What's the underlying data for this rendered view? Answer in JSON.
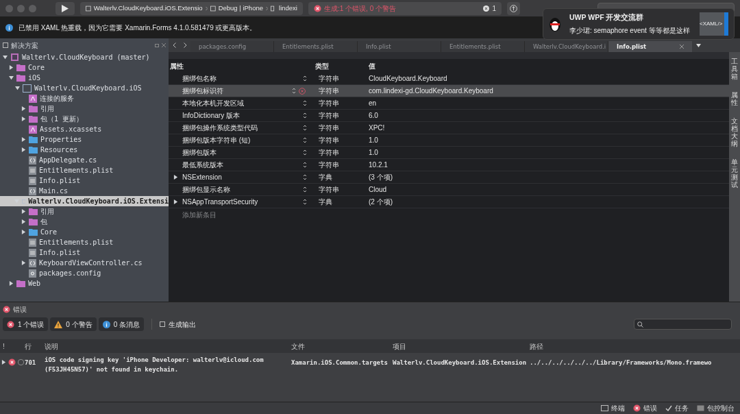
{
  "toolbar": {
    "breadcrumbs": [
      "Walterlv.CloudKeyboard.iOS.Extensio",
      "Debug | iPhone",
      "lindexi"
    ],
    "build_status": "生成:1 个错误, 0 个警告",
    "error_count": "1"
  },
  "notification": {
    "title": "UWP WPF 开发交流群",
    "message": "李少珺: semaphore event 等等都是这样",
    "badge": "<XAML/>"
  },
  "info_bar": {
    "message": "已禁用 XAML 热重载，因为它需要 Xamarin.Forms 4.1.0.581479 或更高版本。"
  },
  "solution_pad": {
    "title": "解决方案",
    "tree": [
      {
        "label": "Walterlv.CloudKeyboard (master)",
        "kind": "solution",
        "expanded": true,
        "selected": false,
        "children": [
          {
            "label": "Core",
            "kind": "folder",
            "expanded": false,
            "selected": false
          },
          {
            "label": "iOS",
            "kind": "folder",
            "expanded": true,
            "selected": false,
            "children": [
              {
                "label": "Walterlv.CloudKeyboard.iOS",
                "kind": "project",
                "expanded": true,
                "selected": false,
                "children": [
                  {
                    "label": "连接的服务",
                    "kind": "special",
                    "selected": false
                  },
                  {
                    "label": "引用",
                    "kind": "folder",
                    "expanded": false,
                    "selected": false
                  },
                  {
                    "label": "包（1 更新）",
                    "kind": "folder",
                    "expanded": false,
                    "selected": false
                  },
                  {
                    "label": "Assets.xcassets",
                    "kind": "special",
                    "selected": false
                  },
                  {
                    "label": "Properties",
                    "kind": "dir",
                    "expanded": false,
                    "selected": false
                  },
                  {
                    "label": "Resources",
                    "kind": "dir",
                    "expanded": false,
                    "selected": false
                  },
                  {
                    "label": "AppDelegate.cs",
                    "kind": "code",
                    "selected": false
                  },
                  {
                    "label": "Entitlements.plist",
                    "kind": "file",
                    "selected": false
                  },
                  {
                    "label": "Info.plist",
                    "kind": "file",
                    "selected": false
                  },
                  {
                    "label": "Main.cs",
                    "kind": "code",
                    "selected": false
                  }
                ]
              },
              {
                "label": "Walterlv.CloudKeyboard.iOS.Extensi",
                "kind": "project",
                "expanded": true,
                "selected": true,
                "children": [
                  {
                    "label": "引用",
                    "kind": "folder",
                    "expanded": false,
                    "selected": false
                  },
                  {
                    "label": "包",
                    "kind": "folder",
                    "expanded": false,
                    "selected": false
                  },
                  {
                    "label": "Core",
                    "kind": "dir",
                    "expanded": false,
                    "selected": false
                  },
                  {
                    "label": "Entitlements.plist",
                    "kind": "file",
                    "selected": false
                  },
                  {
                    "label": "Info.plist",
                    "kind": "file",
                    "selected": false
                  },
                  {
                    "label": "KeyboardViewController.cs",
                    "kind": "code",
                    "expanded": false,
                    "selected": false
                  },
                  {
                    "label": "packages.config",
                    "kind": "config",
                    "selected": false
                  }
                ]
              }
            ]
          },
          {
            "label": "Web",
            "kind": "folder",
            "expanded": false,
            "selected": false
          }
        ]
      }
    ]
  },
  "editor_tabs": [
    {
      "label": "packages.config",
      "selected": false
    },
    {
      "label": "Entitlements.plist",
      "selected": false
    },
    {
      "label": "Info.plist",
      "selected": false
    },
    {
      "label": "Entitlements.plist",
      "selected": false
    },
    {
      "label": "Walterlv.CloudKeyboard.i",
      "selected": false
    },
    {
      "label": "Info.plist",
      "selected": true
    }
  ],
  "plist": {
    "columns": [
      "属性",
      "类型",
      "值"
    ],
    "rows": [
      {
        "property": "捆绑包名称",
        "type": "字符串",
        "value": "CloudKeyboard.Keyboard",
        "selected": false,
        "error": false
      },
      {
        "property": "捆绑包标识符",
        "type": "字符串",
        "value": "com.lindexi-gd.CloudKeyboard.Keyboard",
        "selected": true,
        "error": true
      },
      {
        "property": "本地化本机开发区域",
        "type": "字符串",
        "value": "en",
        "selected": false,
        "error": false
      },
      {
        "property": "InfoDictionary 版本",
        "type": "字符串",
        "value": "6.0",
        "selected": false,
        "error": false
      },
      {
        "property": "捆绑包操作系统类型代码",
        "type": "字符串",
        "value": "XPC!",
        "selected": false,
        "error": false
      },
      {
        "property": "捆绑包版本字符串 (短)",
        "type": "字符串",
        "value": "1.0",
        "selected": false,
        "error": false
      },
      {
        "property": "捆绑包版本",
        "type": "字符串",
        "value": "1.0",
        "selected": false,
        "error": false
      },
      {
        "property": "最低系统版本",
        "type": "字符串",
        "value": "10.2.1",
        "selected": false,
        "error": false
      },
      {
        "property": "NSExtension",
        "type": "字典",
        "value": "(3 个项)",
        "selected": false,
        "error": false,
        "expandable": true
      },
      {
        "property": "捆绑包显示名称",
        "type": "字符串",
        "value": "Cloud",
        "selected": false,
        "error": false
      },
      {
        "property": "NSAppTransportSecurity",
        "type": "字典",
        "value": "(2 个项)",
        "selected": false,
        "error": false,
        "expandable": true
      }
    ],
    "add_entry": "添加新条目"
  },
  "side_strip": [
    "工具箱",
    "属性",
    "文档大纲",
    "单元测试"
  ],
  "error_pad": {
    "title": "错误",
    "filters": [
      {
        "kind": "error",
        "label": "1 个错误"
      },
      {
        "kind": "warning",
        "label": "0 个警告"
      },
      {
        "kind": "info",
        "label": "0 条消息"
      }
    ],
    "build_output": "生成输出",
    "columns": [
      "!",
      "行",
      "说明",
      "文件",
      "项目",
      "路径"
    ],
    "rows": [
      {
        "line": "701",
        "description": "iOS code signing key 'iPhone Developer: walterlv@icloud.com (F53JH45N57)' not found in keychain.",
        "file": "Xamarin.iOS.Common.targets",
        "project": "Walterlv.CloudKeyboard.iOS.Extension",
        "path": "../../../../../../Library/Frameworks/Mono.framewo",
        "checked": false
      }
    ]
  },
  "status_bar": [
    {
      "kind": "terminal",
      "label": "终端"
    },
    {
      "kind": "error",
      "label": "错误"
    },
    {
      "kind": "tasks",
      "label": "任务"
    },
    {
      "kind": "package",
      "label": "包控制台"
    }
  ]
}
